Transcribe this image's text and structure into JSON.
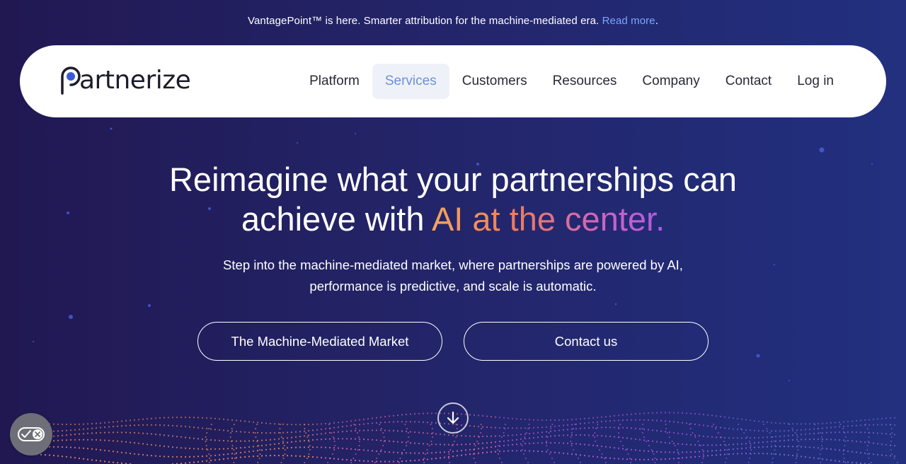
{
  "announcement": {
    "text": "VantagePoint™ is here. Smarter attribution for the machine-mediated era.",
    "link_text": "Read more",
    "suffix": "."
  },
  "nav": {
    "logo_text": "artnerize",
    "logo_alt": "Partnerize",
    "items": [
      {
        "label": "Platform",
        "active": false
      },
      {
        "label": "Services",
        "active": true
      },
      {
        "label": "Customers",
        "active": false
      },
      {
        "label": "Resources",
        "active": false
      },
      {
        "label": "Company",
        "active": false
      },
      {
        "label": "Contact",
        "active": false
      },
      {
        "label": "Log in",
        "active": false
      }
    ]
  },
  "hero": {
    "title_line1": "Reimagine what your partnerships can",
    "title_line2_plain": "achieve with ",
    "title_line2_gradient": "AI at the center.",
    "subtitle_line1": "Step into the machine-mediated market, where partnerships are powered by AI,",
    "subtitle_line2": "performance is predictive, and scale is automatic.",
    "primary_button": "The Machine-Mediated Market",
    "secondary_button": "Contact us"
  },
  "icons": {
    "scroll": "arrow-down-circle-icon",
    "cookie": "cookie-consent-toggle-icon"
  },
  "colors": {
    "background_start": "#211852",
    "background_end": "#22307f",
    "link": "#7aa6ff",
    "nav_active_text": "#6f8fd6",
    "gradient_start": "#f3a55f",
    "gradient_end": "#b05ae0"
  }
}
